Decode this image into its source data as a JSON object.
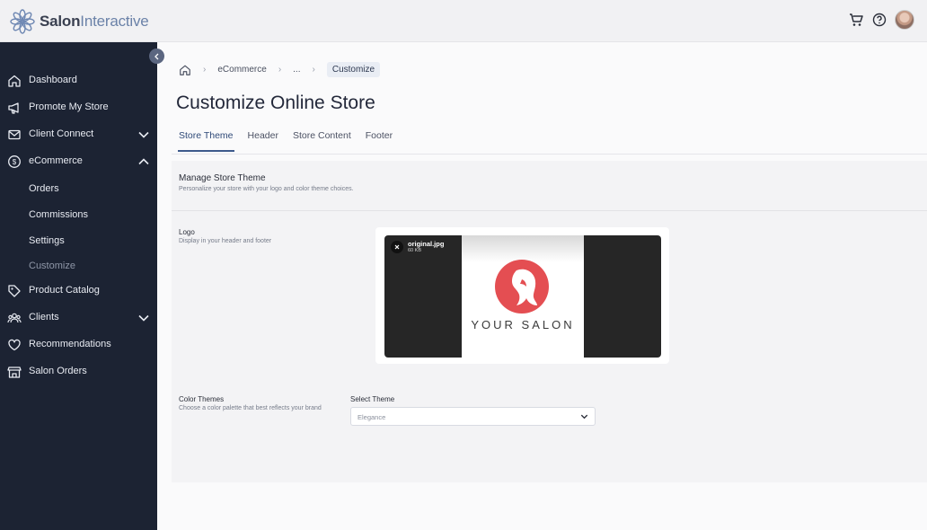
{
  "app": {
    "brand_bold": "Salon",
    "brand_light": "Interactive"
  },
  "topbar": {
    "icons": [
      "cart-icon",
      "help-icon",
      "avatar"
    ]
  },
  "sidebar": {
    "items": [
      {
        "label": "Dashboard",
        "icon": "home-icon"
      },
      {
        "label": "Promote My Store",
        "icon": "megaphone-icon"
      },
      {
        "label": "Client Connect",
        "icon": "mail-icon",
        "expandable": true,
        "expanded": false
      },
      {
        "label": "eCommerce",
        "icon": "dollar-icon",
        "expandable": true,
        "expanded": true
      },
      {
        "label": "Product Catalog",
        "icon": "tag-icon"
      },
      {
        "label": "Clients",
        "icon": "users-icon",
        "expandable": true,
        "expanded": false
      },
      {
        "label": "Recommendations",
        "icon": "heart-icon"
      },
      {
        "label": "Salon Orders",
        "icon": "store-icon"
      }
    ],
    "ecommerce_sub": [
      {
        "label": "Orders"
      },
      {
        "label": "Commissions"
      },
      {
        "label": "Settings"
      },
      {
        "label": "Customize",
        "active": true
      }
    ]
  },
  "breadcrumb": {
    "items": [
      "eCommerce",
      "...",
      "Customize"
    ]
  },
  "page": {
    "title": "Customize Online Store"
  },
  "tabs": [
    {
      "label": "Store Theme",
      "active": true
    },
    {
      "label": "Header"
    },
    {
      "label": "Store Content"
    },
    {
      "label": "Footer"
    }
  ],
  "manage": {
    "title": "Manage Store Theme",
    "desc": "Personalize your store with your logo and color theme choices."
  },
  "logo": {
    "title": "Logo",
    "desc": "Display in your header and footer",
    "file_name": "original.jpg",
    "file_size": "60 KB",
    "image_text": "YOUR SALON"
  },
  "color_themes": {
    "title": "Color Themes",
    "desc": "Choose a color palette that best reflects your brand",
    "select_label": "Select Theme",
    "selected": "Elegance"
  },
  "colors": {
    "sidebar_bg": "#1c2333",
    "accent": "#3d5a8c",
    "logo_red": "#e44e52"
  }
}
